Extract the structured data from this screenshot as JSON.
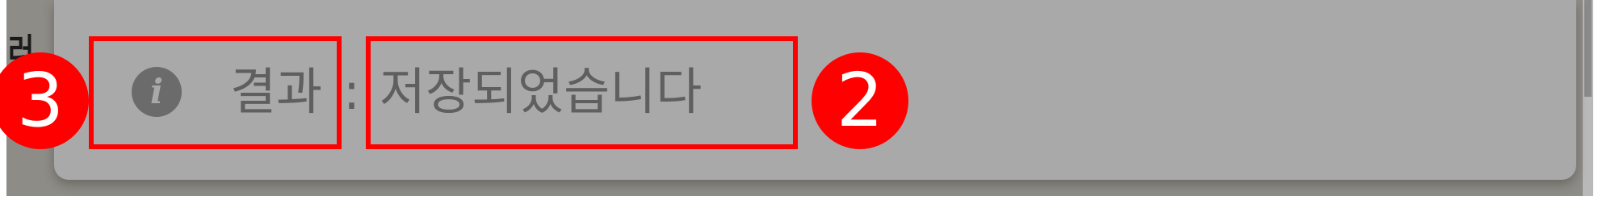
{
  "background": {
    "partial_text": "러"
  },
  "toast": {
    "icon": "info-icon",
    "label": "결과",
    "separator": ":",
    "message": "저장되었습니다"
  },
  "annotations": [
    {
      "badge": "3",
      "target": "toast-label"
    },
    {
      "badge": "2",
      "target": "toast-message"
    }
  ],
  "colors": {
    "overlay": "#8e8c86",
    "toast_bg": "#a9a9a9",
    "text": "#5f5f5f",
    "annotation": "#ff0000"
  }
}
